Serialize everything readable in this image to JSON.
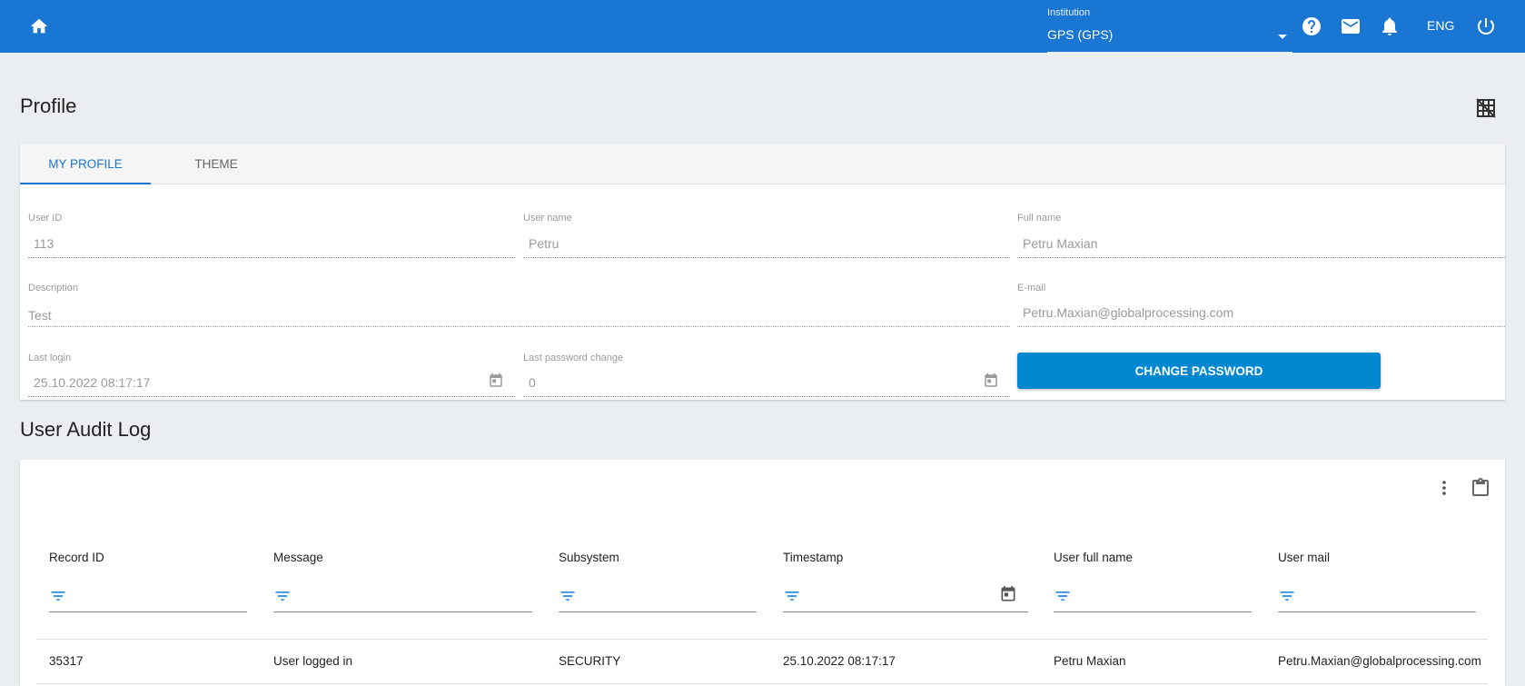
{
  "header": {
    "institution_label": "Institution",
    "institution_value": "GPS (GPS)",
    "language": "ENG",
    "icons": [
      "home-icon",
      "help-icon",
      "mail-icon",
      "bell-icon",
      "power-icon"
    ]
  },
  "profile": {
    "title": "Profile",
    "grid_icon": "grid-off-icon",
    "tabs": [
      {
        "label": "MY PROFILE",
        "active": true
      },
      {
        "label": "THEME",
        "active": false
      }
    ],
    "fields": {
      "user_id": {
        "label": "User ID",
        "value": "113"
      },
      "user_name": {
        "label": "User name",
        "value": "Petru"
      },
      "full_name": {
        "label": "Full name",
        "value": "Petru Maxian"
      },
      "description": {
        "label": "Description",
        "value": "Test"
      },
      "email": {
        "label": "E-mail",
        "value": "Petru.Maxian@globalprocessing.com"
      },
      "last_login": {
        "label": "Last login",
        "value": "25.10.2022 08:17:17"
      },
      "last_password_change": {
        "label": "Last password change",
        "value": "0"
      }
    },
    "change_password_label": "CHANGE PASSWORD"
  },
  "audit": {
    "title": "User Audit Log",
    "columns": [
      "Record ID",
      "Message",
      "Subsystem",
      "Timestamp",
      "User full name",
      "User mail"
    ],
    "rows": [
      [
        "35317",
        "User logged in",
        "SECURITY",
        "25.10.2022 08:17:17",
        "Petru Maxian",
        "Petru.Maxian@globalprocessing.com"
      ]
    ]
  },
  "colors": {
    "primary": "#1976d2",
    "button": "#0288d1",
    "background": "#eaeef1"
  }
}
